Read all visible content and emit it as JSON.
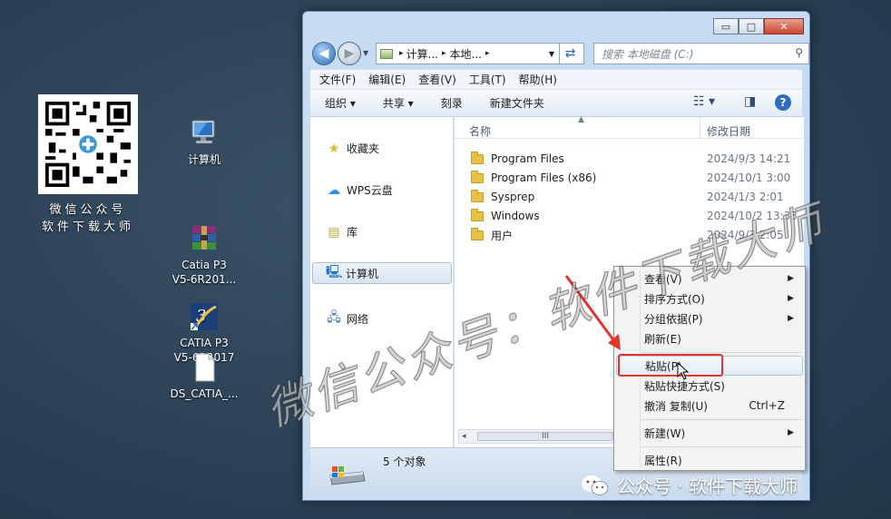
{
  "desktop": {
    "qr_caption_line1": "微信公众号",
    "qr_caption_line2": "软件下载大师",
    "icons": [
      {
        "label": "计算机"
      },
      {
        "label": "Catia P3\nV5-6R201..."
      },
      {
        "label": "CATIA P3\nV5-6R2017"
      },
      {
        "label": "DS_CATIA_..."
      }
    ]
  },
  "window": {
    "controls": {
      "minimize": "▭",
      "maximize": "□",
      "close": "✕"
    },
    "address": {
      "seg1": "计算...",
      "seg2": "本地...",
      "sep": "▸"
    },
    "search_placeholder": "搜索 本地磁盘 (C:)",
    "menu": [
      "文件(F)",
      "编辑(E)",
      "查看(V)",
      "工具(T)",
      "帮助(H)"
    ],
    "toolbar": {
      "organize": "组织 ▾",
      "share": "共享 ▾",
      "burn": "刻录",
      "new_folder": "新建文件夹"
    },
    "nav_pane": [
      {
        "label": "收藏夹",
        "icon": "★"
      },
      {
        "label": "WPS云盘",
        "icon": "☁"
      },
      {
        "label": "库",
        "icon": "▤"
      },
      {
        "label": "计算机",
        "icon": "🖳"
      },
      {
        "label": "网络",
        "icon": "🖧"
      }
    ],
    "columns": {
      "name": "名称",
      "date": "修改日期"
    },
    "files": [
      {
        "name": "Program Files",
        "date": "2024/9/3 14:21"
      },
      {
        "name": "Program Files (x86)",
        "date": "2024/10/1 3:00"
      },
      {
        "name": "Sysprep",
        "date": "2024/1/3 2:01"
      },
      {
        "name": "Windows",
        "date": "2024/10/2 13:33"
      },
      {
        "name": "用户",
        "date": "2024/9/3 2:05"
      }
    ],
    "scroll_grip": "III",
    "status_count": "5 个对象"
  },
  "context_menu": {
    "items": [
      {
        "label": "查看(V)",
        "submenu": true
      },
      {
        "label": "排序方式(O)",
        "submenu": true
      },
      {
        "label": "分组依据(P)",
        "submenu": true
      },
      {
        "label": "刷新(E)"
      },
      {
        "label": "粘贴(P)",
        "highlight": true
      },
      {
        "label": "粘贴快捷方式(S)"
      },
      {
        "label": "撤消 复制(U)",
        "accel": "Ctrl+Z"
      },
      {
        "label": "新建(W)",
        "submenu": true
      },
      {
        "label": "属性(R)"
      }
    ]
  },
  "watermarks": {
    "diagonal": "微信公众号：软件下载大师",
    "corner": "公众号 · 软件下载大师"
  },
  "colors": {
    "accent_red": "#e2352c",
    "folder": "#e9c046",
    "window_frame": "#c7dcf3"
  }
}
